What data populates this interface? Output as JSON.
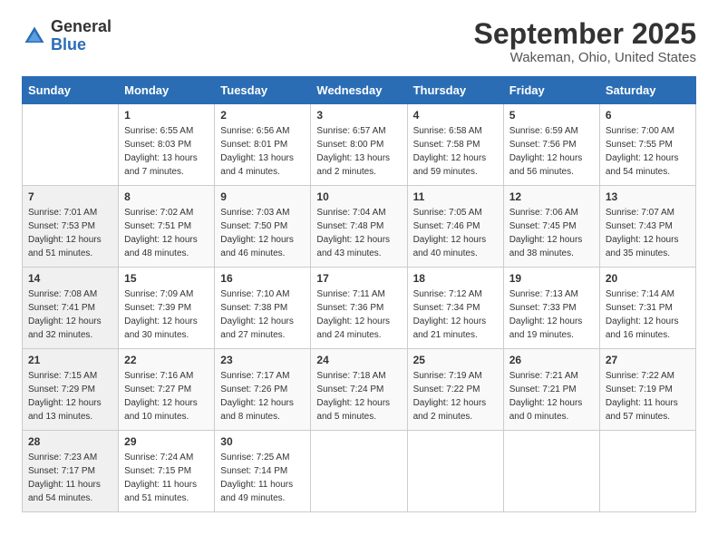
{
  "app": {
    "name_general": "General",
    "name_blue": "Blue"
  },
  "title": "September 2025",
  "subtitle": "Wakeman, Ohio, United States",
  "days_of_week": [
    "Sunday",
    "Monday",
    "Tuesday",
    "Wednesday",
    "Thursday",
    "Friday",
    "Saturday"
  ],
  "weeks": [
    [
      {
        "day": "",
        "info": ""
      },
      {
        "day": "1",
        "info": "Sunrise: 6:55 AM\nSunset: 8:03 PM\nDaylight: 13 hours\nand 7 minutes."
      },
      {
        "day": "2",
        "info": "Sunrise: 6:56 AM\nSunset: 8:01 PM\nDaylight: 13 hours\nand 4 minutes."
      },
      {
        "day": "3",
        "info": "Sunrise: 6:57 AM\nSunset: 8:00 PM\nDaylight: 13 hours\nand 2 minutes."
      },
      {
        "day": "4",
        "info": "Sunrise: 6:58 AM\nSunset: 7:58 PM\nDaylight: 12 hours\nand 59 minutes."
      },
      {
        "day": "5",
        "info": "Sunrise: 6:59 AM\nSunset: 7:56 PM\nDaylight: 12 hours\nand 56 minutes."
      },
      {
        "day": "6",
        "info": "Sunrise: 7:00 AM\nSunset: 7:55 PM\nDaylight: 12 hours\nand 54 minutes."
      }
    ],
    [
      {
        "day": "7",
        "info": "Sunrise: 7:01 AM\nSunset: 7:53 PM\nDaylight: 12 hours\nand 51 minutes."
      },
      {
        "day": "8",
        "info": "Sunrise: 7:02 AM\nSunset: 7:51 PM\nDaylight: 12 hours\nand 48 minutes."
      },
      {
        "day": "9",
        "info": "Sunrise: 7:03 AM\nSunset: 7:50 PM\nDaylight: 12 hours\nand 46 minutes."
      },
      {
        "day": "10",
        "info": "Sunrise: 7:04 AM\nSunset: 7:48 PM\nDaylight: 12 hours\nand 43 minutes."
      },
      {
        "day": "11",
        "info": "Sunrise: 7:05 AM\nSunset: 7:46 PM\nDaylight: 12 hours\nand 40 minutes."
      },
      {
        "day": "12",
        "info": "Sunrise: 7:06 AM\nSunset: 7:45 PM\nDaylight: 12 hours\nand 38 minutes."
      },
      {
        "day": "13",
        "info": "Sunrise: 7:07 AM\nSunset: 7:43 PM\nDaylight: 12 hours\nand 35 minutes."
      }
    ],
    [
      {
        "day": "14",
        "info": "Sunrise: 7:08 AM\nSunset: 7:41 PM\nDaylight: 12 hours\nand 32 minutes."
      },
      {
        "day": "15",
        "info": "Sunrise: 7:09 AM\nSunset: 7:39 PM\nDaylight: 12 hours\nand 30 minutes."
      },
      {
        "day": "16",
        "info": "Sunrise: 7:10 AM\nSunset: 7:38 PM\nDaylight: 12 hours\nand 27 minutes."
      },
      {
        "day": "17",
        "info": "Sunrise: 7:11 AM\nSunset: 7:36 PM\nDaylight: 12 hours\nand 24 minutes."
      },
      {
        "day": "18",
        "info": "Sunrise: 7:12 AM\nSunset: 7:34 PM\nDaylight: 12 hours\nand 21 minutes."
      },
      {
        "day": "19",
        "info": "Sunrise: 7:13 AM\nSunset: 7:33 PM\nDaylight: 12 hours\nand 19 minutes."
      },
      {
        "day": "20",
        "info": "Sunrise: 7:14 AM\nSunset: 7:31 PM\nDaylight: 12 hours\nand 16 minutes."
      }
    ],
    [
      {
        "day": "21",
        "info": "Sunrise: 7:15 AM\nSunset: 7:29 PM\nDaylight: 12 hours\nand 13 minutes."
      },
      {
        "day": "22",
        "info": "Sunrise: 7:16 AM\nSunset: 7:27 PM\nDaylight: 12 hours\nand 10 minutes."
      },
      {
        "day": "23",
        "info": "Sunrise: 7:17 AM\nSunset: 7:26 PM\nDaylight: 12 hours\nand 8 minutes."
      },
      {
        "day": "24",
        "info": "Sunrise: 7:18 AM\nSunset: 7:24 PM\nDaylight: 12 hours\nand 5 minutes."
      },
      {
        "day": "25",
        "info": "Sunrise: 7:19 AM\nSunset: 7:22 PM\nDaylight: 12 hours\nand 2 minutes."
      },
      {
        "day": "26",
        "info": "Sunrise: 7:21 AM\nSunset: 7:21 PM\nDaylight: 12 hours\nand 0 minutes."
      },
      {
        "day": "27",
        "info": "Sunrise: 7:22 AM\nSunset: 7:19 PM\nDaylight: 11 hours\nand 57 minutes."
      }
    ],
    [
      {
        "day": "28",
        "info": "Sunrise: 7:23 AM\nSunset: 7:17 PM\nDaylight: 11 hours\nand 54 minutes."
      },
      {
        "day": "29",
        "info": "Sunrise: 7:24 AM\nSunset: 7:15 PM\nDaylight: 11 hours\nand 51 minutes."
      },
      {
        "day": "30",
        "info": "Sunrise: 7:25 AM\nSunset: 7:14 PM\nDaylight: 11 hours\nand 49 minutes."
      },
      {
        "day": "",
        "info": ""
      },
      {
        "day": "",
        "info": ""
      },
      {
        "day": "",
        "info": ""
      },
      {
        "day": "",
        "info": ""
      }
    ]
  ]
}
